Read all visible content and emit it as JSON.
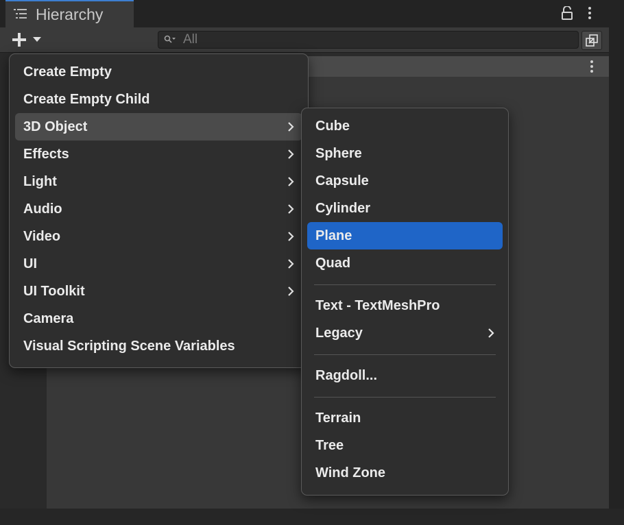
{
  "panel": {
    "tab_title": "Hierarchy",
    "tab_icon": "hierarchy-list-icon",
    "lock_icon": "lock-icon",
    "menu_icon": "kebab-icon"
  },
  "toolbar": {
    "add_icon": "plus-icon",
    "dropdown_icon": "caret-down-icon",
    "search_placeholder": "All",
    "search_icon": "search-filter-icon",
    "scene_button_icon": "scene-visibility-icon"
  },
  "main_menu": {
    "items": [
      {
        "label": "Create Empty",
        "submenu": false,
        "state": "normal"
      },
      {
        "label": "Create Empty Child",
        "submenu": false,
        "state": "normal"
      },
      {
        "label": "3D Object",
        "submenu": true,
        "state": "hover"
      },
      {
        "label": "Effects",
        "submenu": true,
        "state": "normal"
      },
      {
        "label": "Light",
        "submenu": true,
        "state": "normal"
      },
      {
        "label": "Audio",
        "submenu": true,
        "state": "normal"
      },
      {
        "label": "Video",
        "submenu": true,
        "state": "normal"
      },
      {
        "label": "UI",
        "submenu": true,
        "state": "normal"
      },
      {
        "label": "UI Toolkit",
        "submenu": true,
        "state": "normal"
      },
      {
        "label": "Camera",
        "submenu": false,
        "state": "normal"
      },
      {
        "label": "Visual Scripting Scene Variables",
        "submenu": false,
        "state": "normal"
      }
    ]
  },
  "sub_menu": {
    "groups": [
      [
        {
          "label": "Cube",
          "submenu": false,
          "state": "normal"
        },
        {
          "label": "Sphere",
          "submenu": false,
          "state": "normal"
        },
        {
          "label": "Capsule",
          "submenu": false,
          "state": "normal"
        },
        {
          "label": "Cylinder",
          "submenu": false,
          "state": "normal"
        },
        {
          "label": "Plane",
          "submenu": false,
          "state": "selected"
        },
        {
          "label": "Quad",
          "submenu": false,
          "state": "normal"
        }
      ],
      [
        {
          "label": "Text - TextMeshPro",
          "submenu": false,
          "state": "normal"
        },
        {
          "label": "Legacy",
          "submenu": true,
          "state": "normal"
        }
      ],
      [
        {
          "label": "Ragdoll...",
          "submenu": false,
          "state": "normal"
        }
      ],
      [
        {
          "label": "Terrain",
          "submenu": false,
          "state": "normal"
        },
        {
          "label": "Tree",
          "submenu": false,
          "state": "normal"
        },
        {
          "label": "Wind Zone",
          "submenu": false,
          "state": "normal"
        }
      ]
    ]
  },
  "colors": {
    "accent_selected": "#1f65c7",
    "hover": "#4b4b4b",
    "menu_bg": "#2e2e2e",
    "tab_accent": "#3d7fd1"
  }
}
